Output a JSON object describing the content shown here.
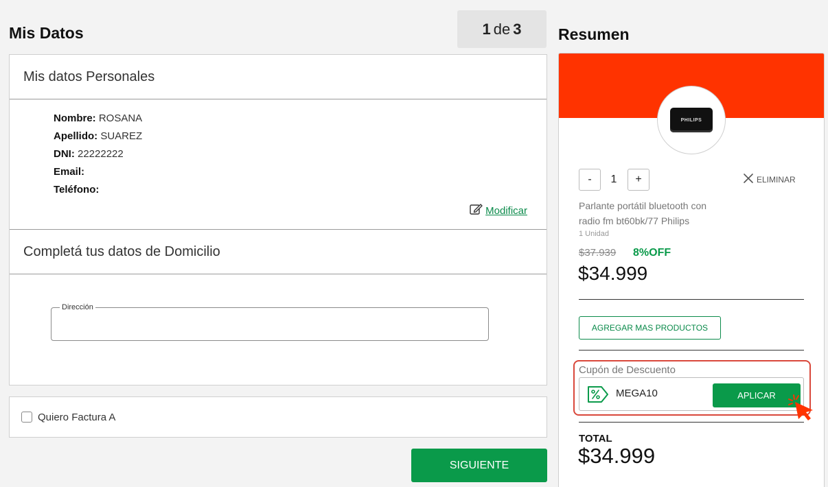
{
  "header": {
    "title": "Mis Datos",
    "step": {
      "current": "1",
      "sep": "de",
      "total": "3"
    }
  },
  "personal": {
    "title": "Mis datos Personales",
    "rows": [
      {
        "key": "Nombre:",
        "value": "ROSANA"
      },
      {
        "key": "Apellido:",
        "value": "SUAREZ"
      },
      {
        "key": "DNI:",
        "value": "22222222"
      },
      {
        "key": "Email:",
        "value": ""
      },
      {
        "key": "Teléfono:",
        "value": ""
      }
    ],
    "modify_label": "Modificar"
  },
  "address": {
    "title": "Completá tus datos de Domicilio",
    "field_label": "Dirección",
    "value": ""
  },
  "factura": {
    "label": "Quiero Factura A",
    "checked": false
  },
  "next_button": "SIGUIENTE",
  "summary": {
    "title": "Resumen",
    "product": {
      "brand_on_image": "PHILIPS",
      "quantity": "1",
      "minus": "-",
      "plus": "+",
      "remove_label": "ELIMINAR",
      "name": "Parlante portátil bluetooth con radio fm bt60bk/77 Philips",
      "unit": "1 Unidad",
      "old_price": "$37.939",
      "discount": "8%OFF",
      "price": "$34.999"
    },
    "add_more_label": "AGREGAR MAS PRODUCTOS",
    "coupon": {
      "title": "Cupón de Descuento",
      "code": "MEGA10",
      "apply_label": "APLICAR"
    },
    "total_label": "TOTAL",
    "total_value": "$34.999"
  },
  "colors": {
    "accent_green": "#0a9a4a",
    "banner_red": "#ff3300",
    "highlight_red": "#d9473a"
  },
  "icons": [
    "pencil-icon",
    "close-icon",
    "coupon-tag-icon",
    "cursor-click-icon"
  ]
}
